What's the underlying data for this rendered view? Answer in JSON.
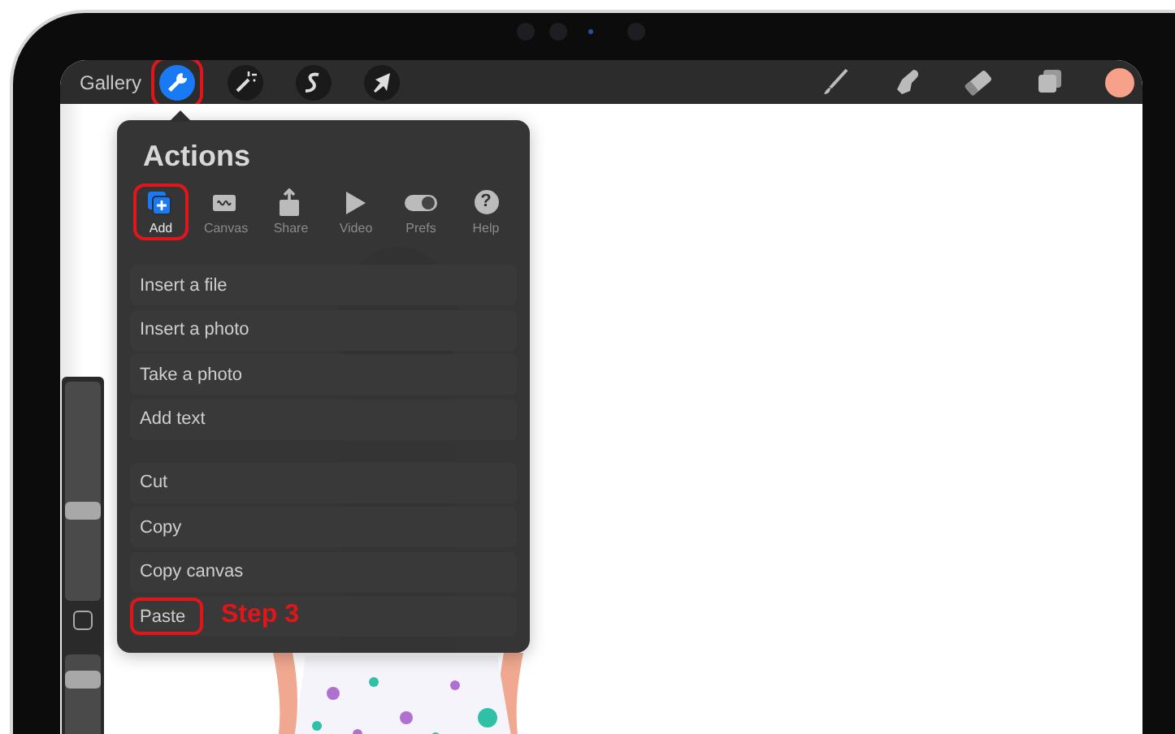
{
  "toolbar": {
    "gallery": "Gallery",
    "tools": [
      {
        "kind": "wrench",
        "selected": true,
        "highlighted": true
      },
      {
        "kind": "wand",
        "selected": false,
        "highlighted": false
      },
      {
        "kind": "selection",
        "selected": false,
        "highlighted": false
      },
      {
        "kind": "transform",
        "selected": false,
        "highlighted": false
      }
    ],
    "right_tools": [
      {
        "kind": "brush"
      },
      {
        "kind": "smudge"
      },
      {
        "kind": "eraser"
      },
      {
        "kind": "layers"
      }
    ]
  },
  "sidebar": {
    "sliders": [
      {
        "level": 0.42
      },
      {
        "level": 0.78
      }
    ]
  },
  "actions": {
    "title": "Actions",
    "tabs": [
      {
        "kind": "add",
        "label": "Add",
        "selected": true,
        "highlighted": true
      },
      {
        "kind": "canvas",
        "label": "Canvas",
        "selected": false,
        "highlighted": false
      },
      {
        "kind": "share",
        "label": "Share",
        "selected": false,
        "highlighted": false
      },
      {
        "kind": "video",
        "label": "Video",
        "selected": false,
        "highlighted": false
      },
      {
        "kind": "prefs",
        "label": "Prefs",
        "selected": false,
        "highlighted": false
      },
      {
        "kind": "help",
        "label": "Help",
        "glyph": "?",
        "selected": false,
        "highlighted": false
      }
    ],
    "groups": [
      [
        {
          "label": "Insert a file",
          "highlighted": false
        },
        {
          "label": "Insert a photo",
          "highlighted": false
        },
        {
          "label": "Take a photo",
          "highlighted": false
        },
        {
          "label": "Add text",
          "highlighted": false
        }
      ],
      [
        {
          "label": "Cut",
          "highlighted": false
        },
        {
          "label": "Copy",
          "highlighted": false
        },
        {
          "label": "Copy canvas",
          "highlighted": false
        },
        {
          "label": "Paste",
          "highlighted": true,
          "note": "Step 3"
        }
      ]
    ]
  }
}
